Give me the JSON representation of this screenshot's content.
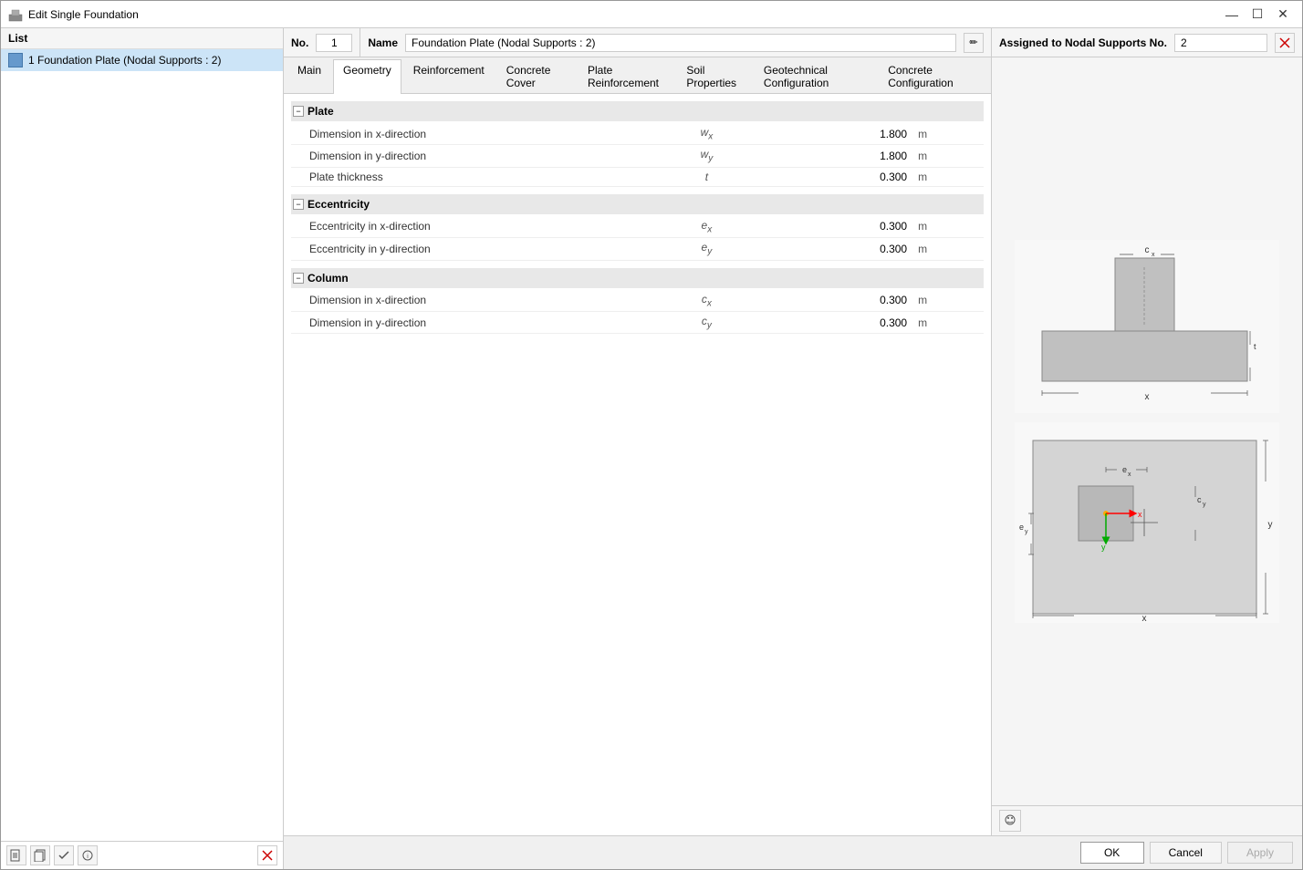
{
  "window": {
    "title": "Edit Single Foundation"
  },
  "titlebar_controls": {
    "minimize": "—",
    "maximize": "☐",
    "close": "✕"
  },
  "list": {
    "header": "List",
    "items": [
      {
        "id": 1,
        "label": "Foundation Plate (Nodal Supports : 2)"
      }
    ]
  },
  "toolbar_buttons": {
    "new": "📄",
    "copy": "📋",
    "check": "✓",
    "info": "ℹ",
    "delete": "✕"
  },
  "form_header": {
    "no_label": "No.",
    "no_value": "1",
    "name_label": "Name",
    "name_value": "Foundation Plate (Nodal Supports : 2)"
  },
  "assigned": {
    "label": "Assigned to Nodal Supports No.",
    "value": "2"
  },
  "tabs": [
    {
      "id": "main",
      "label": "Main",
      "active": false
    },
    {
      "id": "geometry",
      "label": "Geometry",
      "active": true
    },
    {
      "id": "reinforcement",
      "label": "Reinforcement",
      "active": false
    },
    {
      "id": "concrete-cover",
      "label": "Concrete Cover",
      "active": false
    },
    {
      "id": "plate-reinforcement",
      "label": "Plate Reinforcement",
      "active": false
    },
    {
      "id": "soil-properties",
      "label": "Soil Properties",
      "active": false
    },
    {
      "id": "geotechnical-configuration",
      "label": "Geotechnical Configuration",
      "active": false
    },
    {
      "id": "concrete-configuration",
      "label": "Concrete Configuration",
      "active": false
    }
  ],
  "sections": {
    "plate": {
      "title": "Plate",
      "rows": [
        {
          "label": "Dimension in x-direction",
          "symbol": "wx",
          "value": "1.800",
          "unit": "m"
        },
        {
          "label": "Dimension in y-direction",
          "symbol": "wy",
          "value": "1.800",
          "unit": "m"
        },
        {
          "label": "Plate thickness",
          "symbol": "t",
          "value": "0.300",
          "unit": "m"
        }
      ]
    },
    "eccentricity": {
      "title": "Eccentricity",
      "rows": [
        {
          "label": "Eccentricity in x-direction",
          "symbol": "ex",
          "value": "0.300",
          "unit": "m"
        },
        {
          "label": "Eccentricity in y-direction",
          "symbol": "ey",
          "value": "0.300",
          "unit": "m"
        }
      ]
    },
    "column": {
      "title": "Column",
      "rows": [
        {
          "label": "Dimension in x-direction",
          "symbol": "cx",
          "value": "0.300",
          "unit": "m"
        },
        {
          "label": "Dimension in y-direction",
          "symbol": "cy",
          "value": "0.300",
          "unit": "m"
        }
      ]
    }
  },
  "buttons": {
    "ok": "OK",
    "cancel": "Cancel",
    "apply": "Apply"
  }
}
